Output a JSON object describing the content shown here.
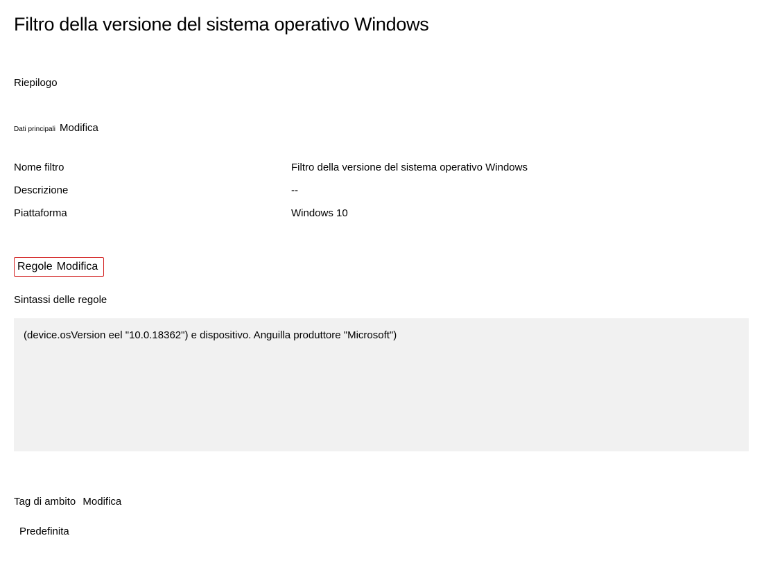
{
  "title": "Filtro della versione del sistema operativo Windows",
  "summary": {
    "heading": "Riepilogo"
  },
  "main_data": {
    "label": "Dati principali",
    "edit": "Modifica"
  },
  "fields": {
    "name": {
      "label": "Nome filtro",
      "value": "Filtro della versione del sistema operativo Windows"
    },
    "description": {
      "label": "Descrizione",
      "value": "--"
    },
    "platform": {
      "label": "Piattaforma",
      "value": "Windows 10"
    }
  },
  "rules": {
    "label": "Regole",
    "edit": "Modifica",
    "syntax_label": "Sintassi delle regole",
    "syntax_value": "(device.osVersion eel \"10.0.18362\") e dispositivo. Anguilla produttore \"Microsoft\")"
  },
  "scope": {
    "label": "Tag di ambito",
    "edit": "Modifica",
    "value": "Predefinita"
  }
}
